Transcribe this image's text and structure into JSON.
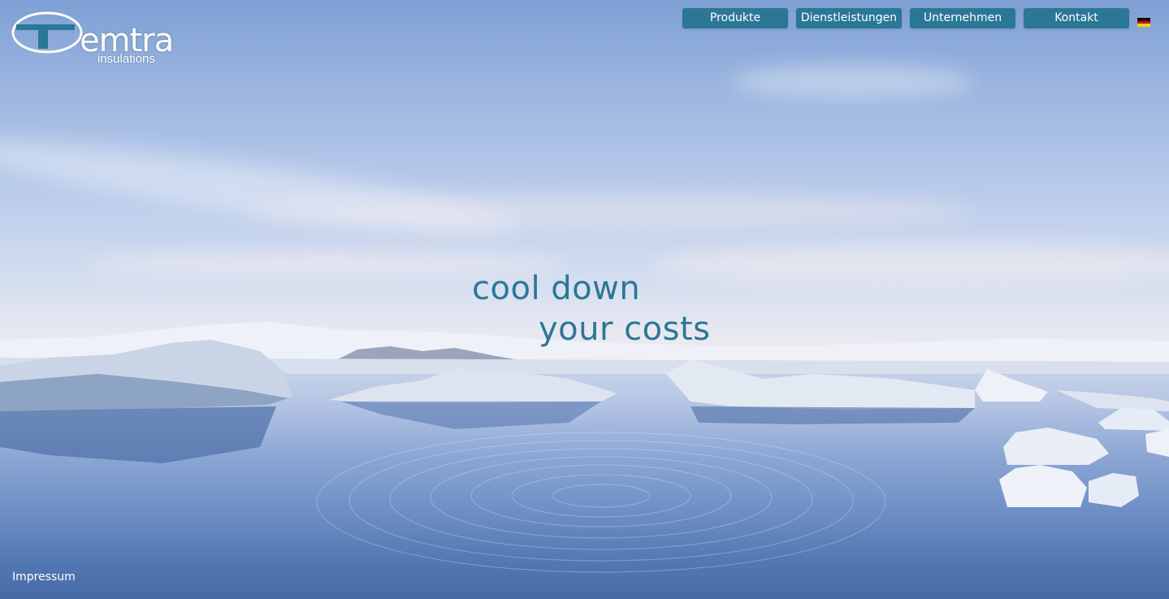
{
  "brand": {
    "name": "emtra",
    "tagline": "insulations"
  },
  "nav": {
    "items": [
      {
        "label": "Produkte"
      },
      {
        "label": "Dienstleistungen"
      },
      {
        "label": "Unternehmen"
      },
      {
        "label": "Kontakt"
      }
    ],
    "language_flag": "german-flag-icon"
  },
  "hero": {
    "line1": "cool down",
    "line2": "your costs",
    "background": "arctic-lagoon-photo"
  },
  "footer": {
    "impressum": "Impressum"
  },
  "colors": {
    "accent": "#2b7796",
    "nav_text": "#ffffff"
  }
}
